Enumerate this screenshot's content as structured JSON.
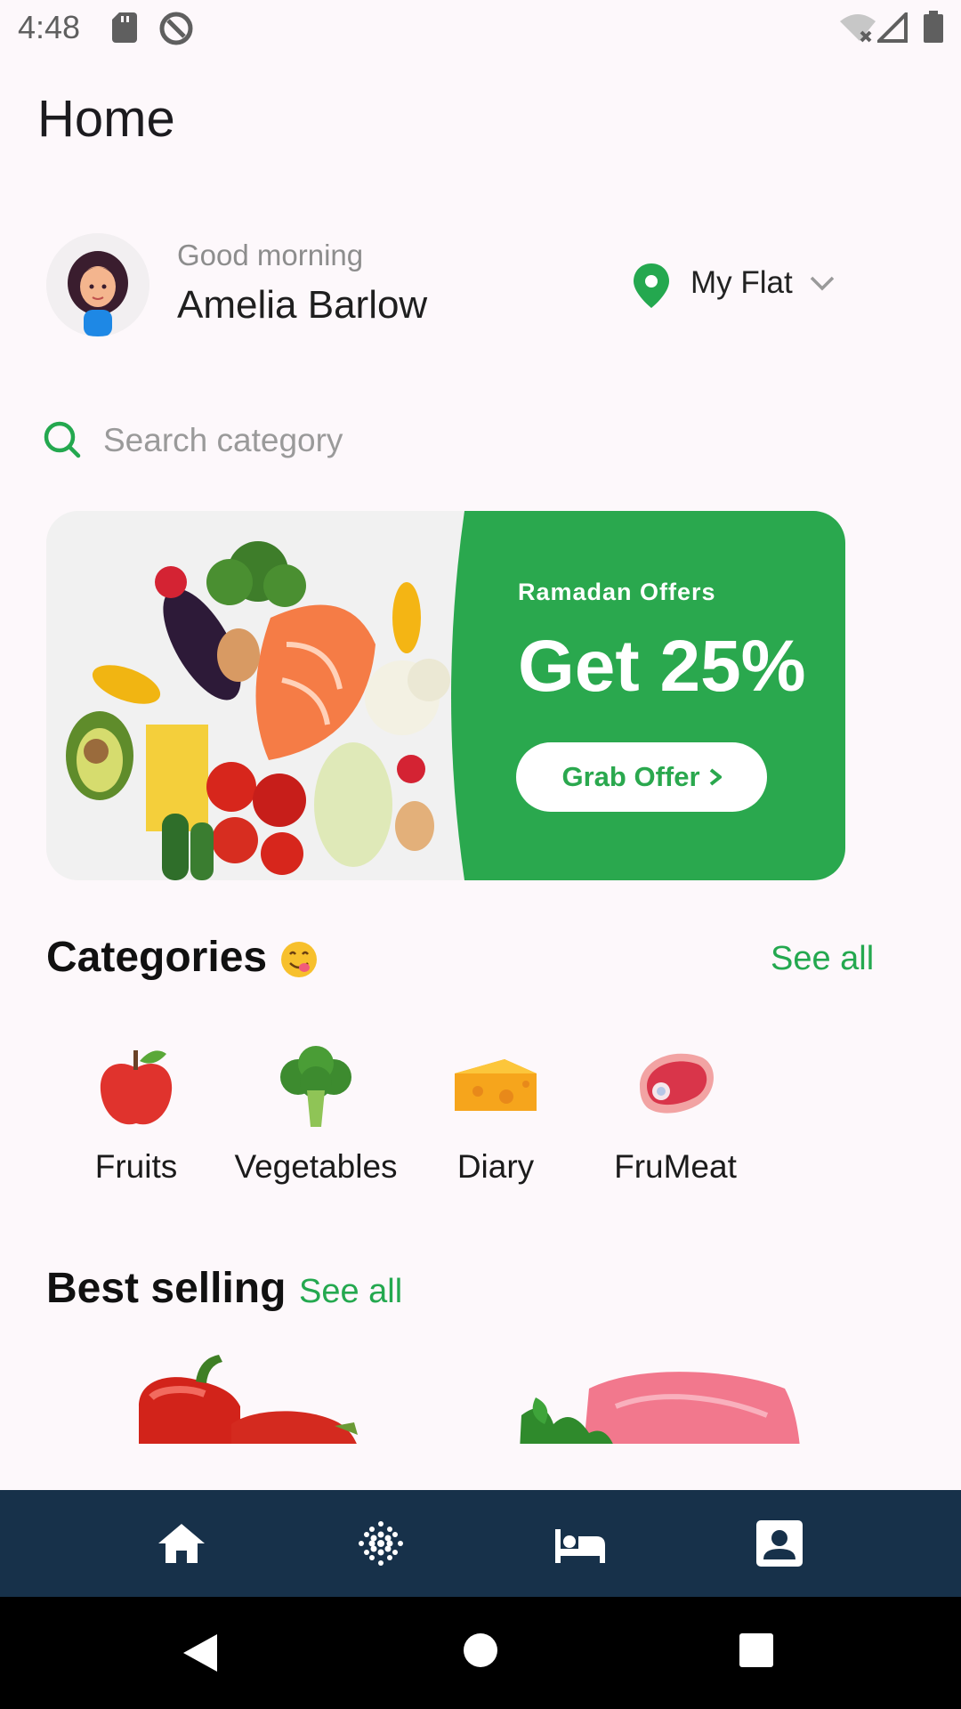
{
  "status_bar": {
    "time": "4:48"
  },
  "page": {
    "title": "Home"
  },
  "greeting": {
    "salutation": "Good morning",
    "name": "Amelia Barlow"
  },
  "location": {
    "label": "My Flat"
  },
  "search": {
    "placeholder": "Search category",
    "value": ""
  },
  "banner": {
    "subtitle": "Ramadan Offers",
    "title": "Get 25%",
    "button_label": "Grab Offer",
    "accent_color": "#2aa84e"
  },
  "categories": {
    "title": "Categories",
    "see_all": "See all",
    "items": [
      {
        "label": "Fruits",
        "icon": "apple-icon"
      },
      {
        "label": "Vegetables",
        "icon": "broccoli-icon"
      },
      {
        "label": "Diary",
        "icon": "cheese-icon"
      },
      {
        "label": "FruMeat",
        "icon": "meat-icon"
      }
    ]
  },
  "best_selling": {
    "title": "Best selling",
    "see_all": "See all"
  },
  "bottom_nav": {
    "items": [
      {
        "icon": "home-icon"
      },
      {
        "icon": "grid-dots-icon"
      },
      {
        "icon": "bed-icon"
      },
      {
        "icon": "contact-card-icon"
      }
    ]
  },
  "colors": {
    "brand_green": "#24a84f",
    "nav_background": "#17314a",
    "background": "#fdf8fb"
  }
}
